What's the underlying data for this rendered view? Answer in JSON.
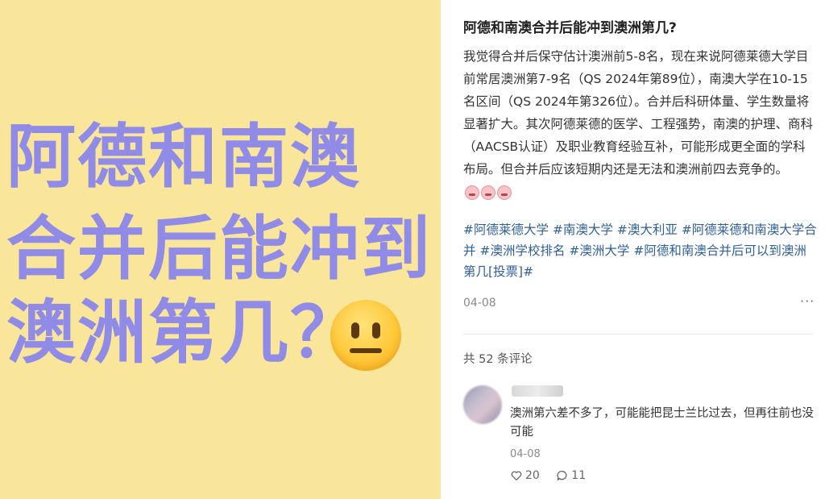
{
  "cover": {
    "line1": "阿德和南澳",
    "line2": "合并后能冲到",
    "line3": "澳洲第几？",
    "emoji": "neutral-face-icon"
  },
  "post": {
    "title": "阿德和南澳合并后能冲到澳洲第几?",
    "body_text": "我觉得合并后保守估计澳洲前5-8名，现在来说阿德莱德大学目前常居澳洲第7-9名（QS 2024年第89位），南澳大学在10-15名区间（QS 2024年第326位）。合并后科研体量、学生数量将显著扩大。其次阿德莱德的医学、工程强势，南澳的护理、商科（AACSB认证）及职业教育经验互补，可能形成更全面的学科布局。但合并后应该短期内还是无法和澳洲前四去竞争的。",
    "body_emojis": [
      "crying-face-icon",
      "crying-face-icon",
      "crying-face-icon"
    ],
    "tags": [
      "#阿德莱德大学",
      "#南澳大学",
      "#澳大利亚",
      "#阿德莱德和南澳大学合并",
      "#澳洲学校排名",
      "#澳洲大学",
      "#阿德和南澳合并后可以到澳洲第几[投票]#"
    ],
    "date": "04-08",
    "more_label": "···"
  },
  "comments": {
    "count_label": "共 52 条评论",
    "items": [
      {
        "text": "澳洲第六差不多了，可能能把昆士兰比过去，但再往前也没可能",
        "date": "04-08",
        "likes": "20",
        "replies": "11"
      }
    ]
  },
  "colors": {
    "cover_bg": "#fae69a",
    "cover_text": "#8f8be6",
    "tag": "#2f5f9a"
  }
}
